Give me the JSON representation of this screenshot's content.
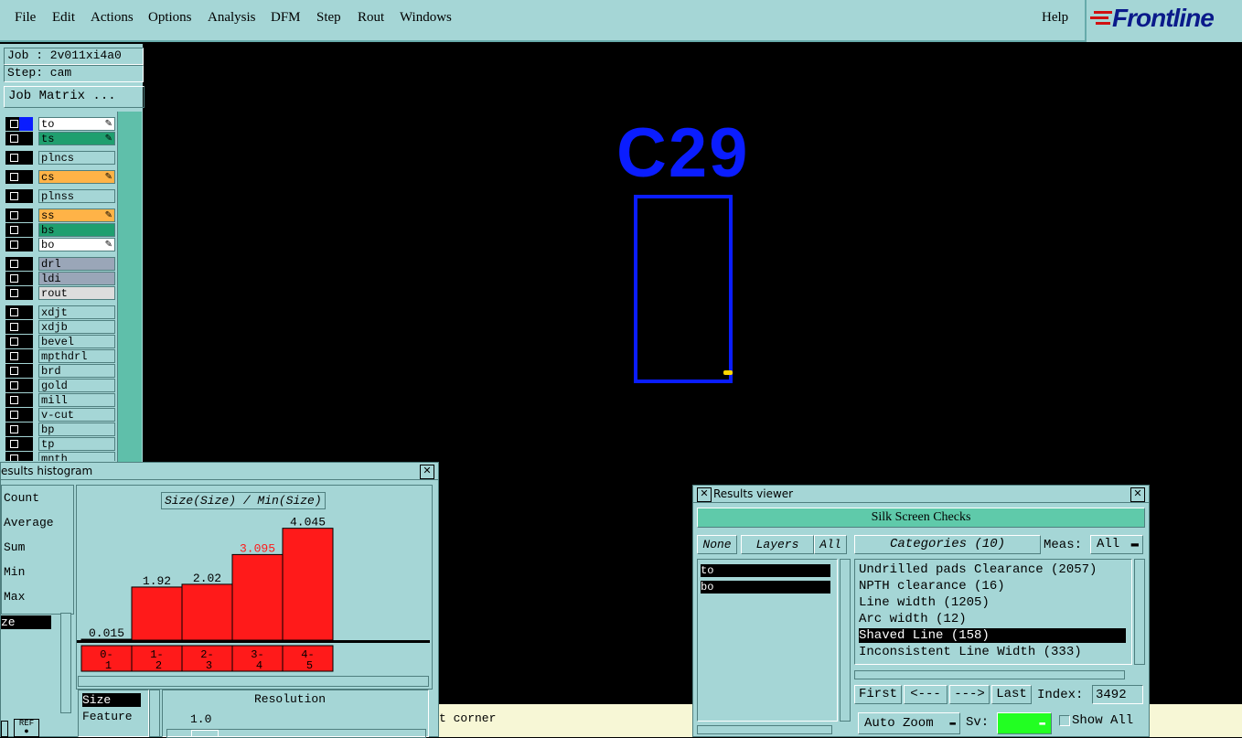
{
  "menu": {
    "items": [
      "File",
      "Edit",
      "Actions",
      "Options",
      "Analysis",
      "DFM",
      "Step",
      "Rout",
      "Windows"
    ],
    "help": "Help",
    "logo": "Frontline"
  },
  "job": {
    "job_label": "Job : 2v011xi4a0",
    "step_label": "Step: cam",
    "matrix_button": "Job Matrix ..."
  },
  "layers": [
    {
      "name": "to",
      "color": "#ffffff",
      "pen": true,
      "active": true
    },
    {
      "name": "ts",
      "color": "#1f9f6f",
      "pen": true
    },
    {
      "name": "plncs",
      "color": "#a5d6d6"
    },
    {
      "name": "cs",
      "color": "#ffb347",
      "pen": true
    },
    {
      "name": "plnss",
      "color": "#a5d6d6"
    },
    {
      "name": "ss",
      "color": "#ffb347",
      "pen": true
    },
    {
      "name": "bs",
      "color": "#1f9f6f"
    },
    {
      "name": "bo",
      "color": "#ffffff",
      "pen": true
    },
    {
      "name": "drl",
      "color": "#9aa6b8"
    },
    {
      "name": "ldi",
      "color": "#9aa6b8"
    },
    {
      "name": "rout",
      "color": "#dddddd"
    },
    {
      "name": "xdjt",
      "color": "#a5d6d6"
    },
    {
      "name": "xdjb",
      "color": "#a5d6d6"
    },
    {
      "name": "bevel",
      "color": "#a5d6d6"
    },
    {
      "name": "mpthdrl",
      "color": "#a5d6d6"
    },
    {
      "name": "brd",
      "color": "#a5d6d6"
    },
    {
      "name": "gold",
      "color": "#a5d6d6"
    },
    {
      "name": "mill",
      "color": "#a5d6d6"
    },
    {
      "name": "v-cut",
      "color": "#a5d6d6"
    },
    {
      "name": "bp",
      "color": "#a5d6d6"
    },
    {
      "name": "tp",
      "color": "#a5d6d6"
    },
    {
      "name": "mnth",
      "color": "#a5d6d6"
    }
  ],
  "canvas": {
    "component_label": "C29",
    "shape_color": "#0a1dff",
    "marker_color": "#ffd700"
  },
  "status": {
    "text": "t corner"
  },
  "histogram": {
    "title": "esults histogram",
    "stats": [
      "Count",
      "Average",
      "Sum",
      "Min",
      "Max"
    ],
    "selected_field": "ze",
    "chart_title": "Size(Size) / Min(Size)",
    "size_list": [
      "Size",
      "Feature"
    ],
    "resolution_label": "Resolution",
    "resolution_value": "1.0"
  },
  "chart_data": {
    "type": "bar",
    "title": "Size(Size) / Min(Size)",
    "categories": [
      "0-1",
      "1-2",
      "2-3",
      "3-4",
      "4-5"
    ],
    "values": [
      0.015,
      1.92,
      2.02,
      3.095,
      4.045
    ],
    "value_labels": [
      "0.015",
      "1.92",
      "2.02",
      "3.095",
      "4.045"
    ],
    "highlight_index": 3,
    "highlight_color": "#ff1a1a",
    "bar_color": "#ff1a1a",
    "ylim": [
      0,
      4.1
    ]
  },
  "results_viewer": {
    "title": "Results viewer",
    "check_set": "Silk Screen Checks",
    "none_button": "None",
    "layers_button": "Layers",
    "all_button": "All",
    "categories_button": "Categories (10)",
    "meas_label": "Meas:",
    "meas_value": "All",
    "layer_list": [
      "to",
      "bo"
    ],
    "categories": [
      "Undrilled pads Clearance (2057)",
      "NPTH clearance (16)",
      "Line width (1205)",
      "Arc width (12)",
      "Shaved Line (158)",
      "Inconsistent Line Width (333)"
    ],
    "selected_category": 4,
    "first_button": "First",
    "prev_button": "<---",
    "next_button": "--->",
    "last_button": "Last",
    "index_label": "Index:",
    "index_value": "3492",
    "auto_zoom": "Auto Zoom",
    "sv_label": "Sv:",
    "show_all": "Show All"
  }
}
